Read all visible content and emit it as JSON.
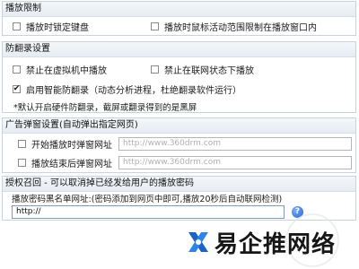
{
  "playback_limit": {
    "title": "播放限制",
    "lock_keyboard_label": "播放时锁定键盘",
    "limit_mouse_label": "播放时鼠标活动范围限制在播放窗口内"
  },
  "anti_record": {
    "title": "防翻录设置",
    "disable_vm_label": "禁止在虚拟机中播放",
    "disable_online_label": "禁止在联网状态下播放",
    "smart_anti_record_label": "启用智能防翻录（动态分析进程，杜绝翻录软件运行）",
    "note": "*默认开启硬件防翻录，截屏或翻录得到的是黑屏"
  },
  "ad_popup": {
    "title": "广告弹窗设置(自动弹出指定网页)",
    "start_popup_label": "开始播放时弹窗网址",
    "start_popup_placeholder": "http://www.360drm.com",
    "end_popup_label": "播放结束后弹窗网址",
    "end_popup_placeholder": "http://www.360drm.com"
  },
  "auth_revoke": {
    "title": "授权召回 - 可以取消掉已经发给用户的播放密码",
    "blacklist_label": "播放密码黑名单网址:(密码添加到网页中即可,播放20秒后自动联网检测)",
    "blacklist_value": "http://",
    "help_icon_glyph": "?"
  },
  "logo": {
    "text": "易企推网络"
  }
}
